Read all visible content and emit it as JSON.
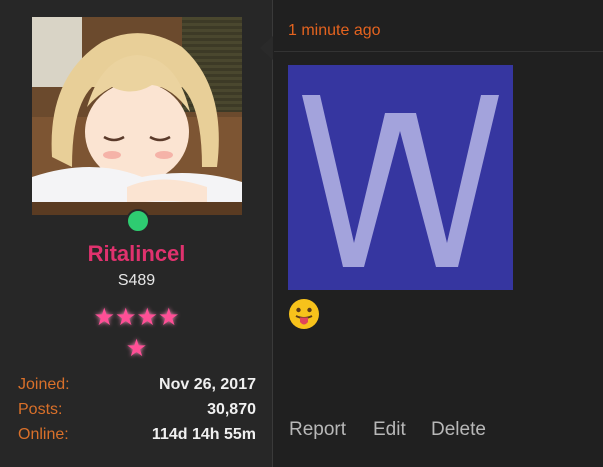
{
  "user": {
    "username": "Ritalincel",
    "title": "S489",
    "stars_row1": "★★★★",
    "stars_row2": "★",
    "online": true,
    "stats": [
      {
        "label": "Joined:",
        "value": "Nov 26, 2017"
      },
      {
        "label": "Posts:",
        "value": "30,870"
      },
      {
        "label": "Online:",
        "value": "114d 14h 55m"
      }
    ]
  },
  "post": {
    "timestamp": "1 minute ago",
    "image_letter": "W",
    "emoji_icon": "tongue-out-face-icon",
    "actions": [
      "Report",
      "Edit",
      "Delete"
    ]
  },
  "colors": {
    "username": "#e0326e",
    "label": "#d9702a",
    "timestamp": "#e4631f",
    "online": "#2ecc71",
    "stars": "#ff4f96",
    "image_bg": "#3636a0",
    "image_letter": "#a3a3dc"
  }
}
